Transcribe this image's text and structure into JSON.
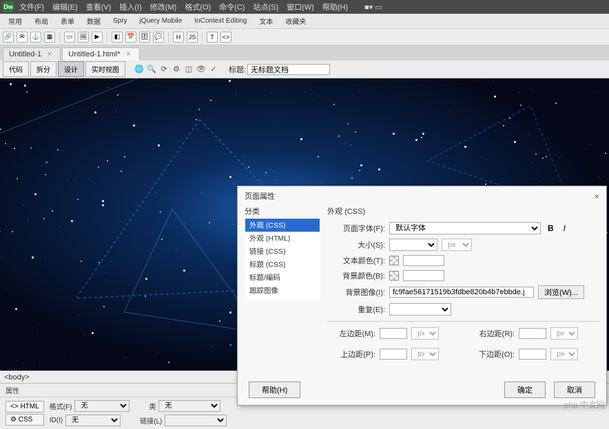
{
  "app": {
    "logo": "Dw"
  },
  "menubar": [
    "文件(F)",
    "编辑(E)",
    "查看(V)",
    "插入(I)",
    "修改(M)",
    "格式(O)",
    "命令(C)",
    "站点(S)",
    "窗口(W)",
    "帮助(H)"
  ],
  "menubar_right": "■▾  ▭",
  "toolbar2_tabs": [
    "常用",
    "布局",
    "表单",
    "数据",
    "Spry",
    "jQuery Mobile",
    "InContext Editing",
    "文本",
    "收藏夹"
  ],
  "doc_tabs": [
    {
      "label": "Untitled-1",
      "close": "×"
    },
    {
      "label": "Untitled-1.html*",
      "close": "×"
    }
  ],
  "view": {
    "buttons": [
      "代码",
      "拆分",
      "设计",
      "实时视图"
    ],
    "title_label": "标题:",
    "title_value": "无标题文档"
  },
  "status": {
    "tag": "<body>"
  },
  "props": {
    "header": "属性",
    "mode_html": "<> HTML",
    "mode_css": "⚙ CSS",
    "format_label": "格式(F)",
    "format_value": "无",
    "class_label": "类",
    "class_value": "无",
    "id_label": "ID(I)",
    "id_value": "无",
    "link_label": "链接(L)",
    "link_value": ""
  },
  "dialog": {
    "title": "页面属性",
    "category_label": "分类",
    "categories": [
      "外观 (CSS)",
      "外观 (HTML)",
      "链接 (CSS)",
      "标题 (CSS)",
      "标题/编码",
      "跟踪图像"
    ],
    "section_title": "外观 (CSS)",
    "font_label": "页面字体(F):",
    "font_value": "默认字体",
    "size_label": "大小(S):",
    "size_unit": "px",
    "text_color_label": "文本颜色(T):",
    "bg_color_label": "背景颜色(B):",
    "bg_image_label": "背景图像(I):",
    "bg_image_value": "fc9fae56171519b3fdbe820b4b7ebbde.j",
    "browse_btn": "浏览(W)...",
    "repeat_label": "重复(E):",
    "margin_left_label": "左边距(M):",
    "margin_right_label": "右边距(R):",
    "margin_top_label": "上边距(P):",
    "margin_bottom_label": "下边距(O):",
    "px": "px",
    "help_btn": "帮助(H)",
    "ok_btn": "确定",
    "cancel_btn": "取消"
  },
  "watermark": "php 中文网"
}
